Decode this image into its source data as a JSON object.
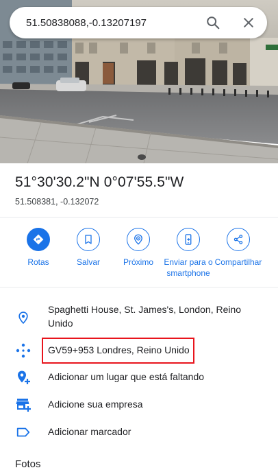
{
  "search": {
    "value": "51.50838088,-0.13207197"
  },
  "place": {
    "coords_dms": "51°30'30.2\"N 0°07'55.5\"W",
    "coords_decimal": "51.508381, -0.132072"
  },
  "actions": [
    {
      "label": "Rotas",
      "icon": "directions-icon"
    },
    {
      "label": "Salvar",
      "icon": "bookmark-icon"
    },
    {
      "label": "Próximo",
      "icon": "nearby-icon"
    },
    {
      "label": "Enviar para o smartphone",
      "icon": "send-to-phone-icon"
    },
    {
      "label": "Compartilhar",
      "icon": "share-icon"
    }
  ],
  "info_rows": [
    {
      "text": "Spaghetti House, St. James's, London, Reino Unido",
      "icon": "location-pin-icon"
    },
    {
      "text": "GV59+953 Londres, Reino Unido",
      "icon": "plus-code-icon"
    },
    {
      "text": "Adicionar um lugar que está faltando",
      "icon": "add-place-icon"
    },
    {
      "text": "Adicione sua empresa",
      "icon": "add-business-icon"
    },
    {
      "text": "Adicionar marcador",
      "icon": "label-icon"
    }
  ],
  "sections": {
    "photos_title": "Fotos"
  },
  "colors": {
    "accent": "#1a73e8",
    "highlight_border": "#e8141c"
  }
}
